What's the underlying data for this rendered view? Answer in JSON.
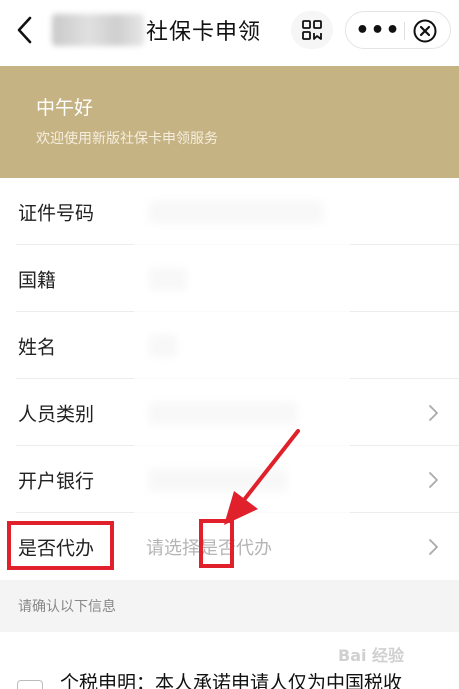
{
  "navbar": {
    "title": "社保卡申领",
    "more_glyph": "•••"
  },
  "banner": {
    "greeting": "中午好",
    "subtitle": "欢迎使用新版社保卡申领服务"
  },
  "form": {
    "rows": [
      {
        "label": "证件号码"
      },
      {
        "label": "国籍"
      },
      {
        "label": "姓名"
      },
      {
        "label": "人员类别"
      },
      {
        "label": "开户银行"
      },
      {
        "label": "是否代办",
        "placeholder": "请选择是否代办"
      }
    ]
  },
  "info": {
    "heading": "请确认以下信息",
    "tax_statement": "个税申明：本人承诺申请人仅为中国税收"
  },
  "watermark": "Bai 经验",
  "colors": {
    "banner": "#c6b383",
    "annotation": "#e0202a"
  },
  "icons": {
    "back": "chevron-left-icon",
    "scan": "scan-icon",
    "more": "more-dots-icon",
    "close": "close-circle-icon",
    "row_arrow": "chevron-right-icon"
  }
}
